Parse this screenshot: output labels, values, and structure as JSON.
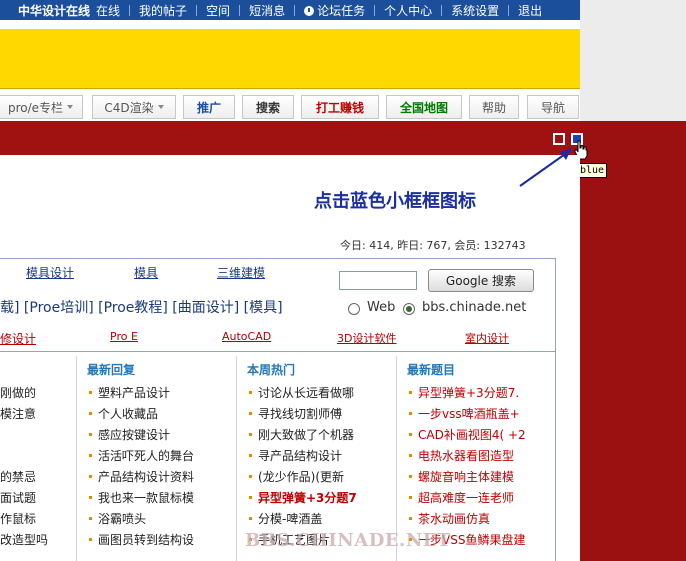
{
  "topbar": {
    "brand": "中华设计在线",
    "status": "在线",
    "items": [
      "我的帖子",
      "空间",
      "短消息",
      "论坛任务",
      "个人中心",
      "系统设置",
      "退出"
    ]
  },
  "tabs": [
    {
      "label": "pro/e专栏",
      "dropdown": true,
      "style": "plain"
    },
    {
      "label": "C4D渲染",
      "dropdown": true,
      "style": "plain"
    },
    {
      "label": "推广",
      "dropdown": false,
      "style": "blue"
    },
    {
      "label": "搜索",
      "dropdown": false,
      "style": "bold"
    },
    {
      "label": "打工赚钱",
      "dropdown": false,
      "style": "red"
    },
    {
      "label": "全国地图",
      "dropdown": false,
      "style": "green"
    },
    {
      "label": "帮助",
      "dropdown": false,
      "style": "plain"
    },
    {
      "label": "导航",
      "dropdown": false,
      "style": "plain"
    }
  ],
  "tooltip": "blue",
  "hint": "点击蓝色小框框图标",
  "stats": "今日: 414, 昨日: 767, 会员: 132743",
  "top_links": [
    "模具设计",
    "模具",
    "三维建模"
  ],
  "proe_links": "载] [Proe培训] [Proe教程] [曲面设计] [模具]",
  "red_links": [
    "修设计",
    "Pro E",
    "AutoCAD",
    "3D设计软件",
    "室内设计"
  ],
  "search": {
    "input_value": "",
    "button_label": "Google 搜索",
    "options": [
      "Web",
      "bbs.chinade.net"
    ],
    "selected": "bbs.chinade.net"
  },
  "columns": [
    {
      "heading": "",
      "items": [
        "刚做的",
        "模注意",
        "",
        "",
        "的禁忌",
        "面试题",
        "作鼠标",
        "改造型吗"
      ]
    },
    {
      "heading": "最新回复",
      "items": [
        "塑料产品设计",
        "个人收藏品",
        "感应按键设计",
        "活活吓死人的舞台",
        "产品结构设计资料",
        "我也来一款鼠标模",
        "浴霸喷头",
        "画图员转到结构设"
      ]
    },
    {
      "heading": "本周热门",
      "items": [
        "讨论从长远看做哪",
        "寻找线切割师傅",
        "刚大致做了个机器",
        "寻产品结构设计",
        "(龙少作品)(更新",
        "异型弹簧+3分题7",
        "分模-啤酒盖",
        "手机工艺图片"
      ]
    },
    {
      "heading": "最新题目",
      "items": [
        "异型弹簧+3分题7.",
        "一步vss啤酒瓶盖+",
        "CAD补画视图4( +2",
        "电热水器看图造型",
        "螺旋音响主体建模",
        "超高难度一连老师",
        "茶水动画仿真",
        "一步VSS鱼鳞果盘建"
      ]
    }
  ],
  "watermark": "BBS.CHINADE.NET",
  "colors": {
    "topbar": "#1b4f9c",
    "banner": "#ffd800",
    "red_band": "#9b1111",
    "accent_blue": "#1b2fa0",
    "column_heading": "#2477b8",
    "hot_red": "#c00000",
    "bullet": "#e08a00"
  }
}
